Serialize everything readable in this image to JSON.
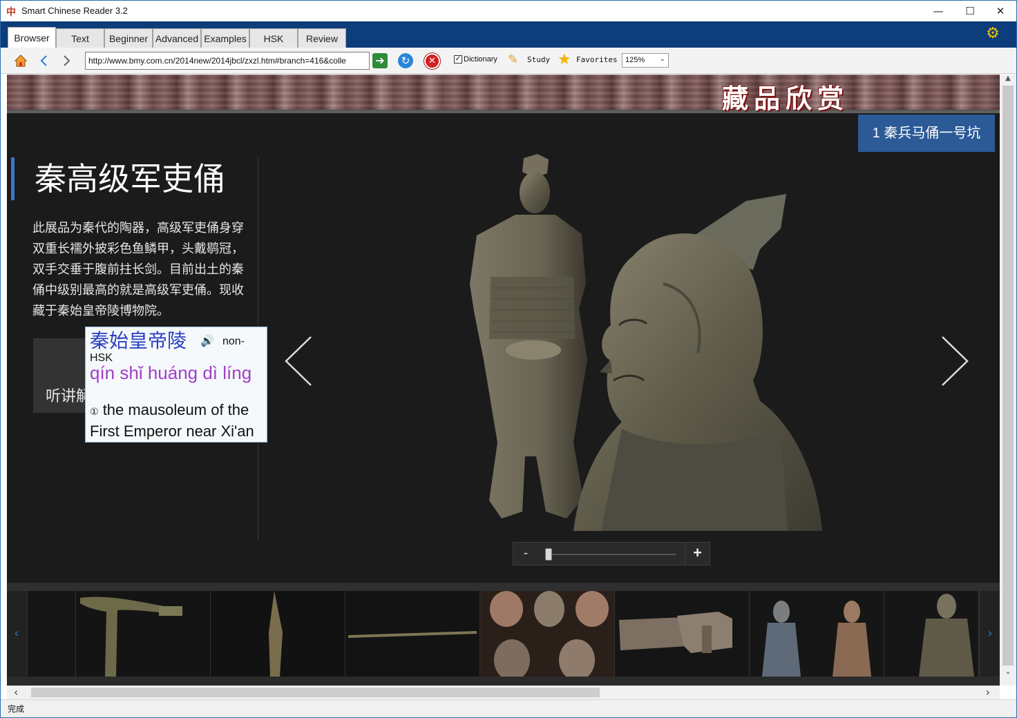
{
  "app": {
    "title": "Smart Chinese Reader 3.2",
    "icon_glyph": "中",
    "window_controls": {
      "minimize": "—",
      "maximize": "☐",
      "close": "✕"
    }
  },
  "tabs": [
    {
      "label": "Browser",
      "active": true
    },
    {
      "label": "Text",
      "active": false
    },
    {
      "label": "Beginner",
      "active": false
    },
    {
      "label": "Advanced",
      "active": false
    },
    {
      "label": "Examples",
      "active": false
    },
    {
      "label": "HSK",
      "active": false
    },
    {
      "label": "Review",
      "active": false
    }
  ],
  "toolbar": {
    "url": "http://www.bmy.com.cn/2014new/2014jbcl/zxzl.htm#branch=416&colle",
    "dictionary_label": "Dictionary",
    "dictionary_checked": true,
    "study_label": "Study",
    "favorites_label": "Favorites",
    "zoom_value": "125%"
  },
  "page": {
    "banner_title": "藏品欣赏",
    "pit_button": "1 秦兵马俑一号坑",
    "exhibit_title": "秦高级军吏俑",
    "description": "此展品为秦代的陶器，高级军吏俑身穿双重长襦外披彩色鱼鳞甲，头戴鹖冠，双手交垂于腹前拄长剑。目前出土的秦俑中级别最高的就是高级军吏俑。现收藏于秦始皇帝陵博物院。",
    "listen_button": "听讲解",
    "zoom_minus": "-",
    "zoom_plus": "+",
    "zoom_level": 0.0
  },
  "popup": {
    "hanzi": "秦始皇帝陵",
    "hsk_line1": "non-",
    "hsk_line2": "HSK",
    "pinyin": "qín shǐ huáng dì líng",
    "def_number": "①",
    "definition": "the mausoleum of the First Emperor near Xi'an"
  },
  "filmstrip": {
    "prev": "‹",
    "next": "›",
    "thumb_names": [
      "ge-halberd",
      "spear-head",
      "sword",
      "warrior-heads",
      "bricks",
      "warrior-pair",
      "warrior-single"
    ]
  },
  "status": {
    "text": "完成"
  },
  "colors": {
    "tab_strip": "#0d3d7a",
    "page_bg": "#1b1b1b",
    "accent_blue": "#2b5a96",
    "popup_hanzi": "#2a3fc0",
    "popup_pinyin": "#a23dc9"
  }
}
